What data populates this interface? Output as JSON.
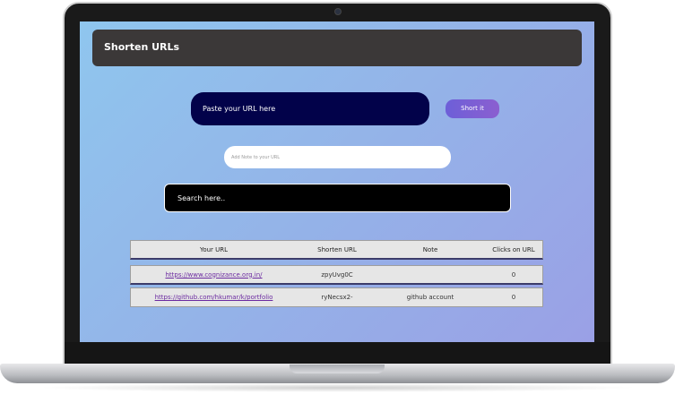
{
  "header": {
    "title": "Shorten URLs"
  },
  "url_input": {
    "placeholder": "Paste your URL here"
  },
  "short_button": {
    "label": "Short it"
  },
  "note_input": {
    "placeholder": "Add Note to your URL"
  },
  "search_input": {
    "placeholder": "Search here.."
  },
  "table": {
    "headers": [
      "Your URL",
      "Shorten URL",
      "Note",
      "Clicks on URL"
    ],
    "rows": [
      {
        "url": "https://www.cognizance.org.in/",
        "short": "zpyUvg0C",
        "note": "",
        "clicks": "0"
      },
      {
        "url": "https://github.com/hkumar/k/portfolio",
        "short": "ryNecsx2-",
        "note": "github account",
        "clicks": "0"
      }
    ]
  },
  "colors": {
    "header_bg": "#3b3838",
    "url_input_bg": "#02024a",
    "button_accent": "#7a5fd5",
    "screen_gradient_start": "#8fc6ee",
    "screen_gradient_end": "#9aa0e6"
  }
}
